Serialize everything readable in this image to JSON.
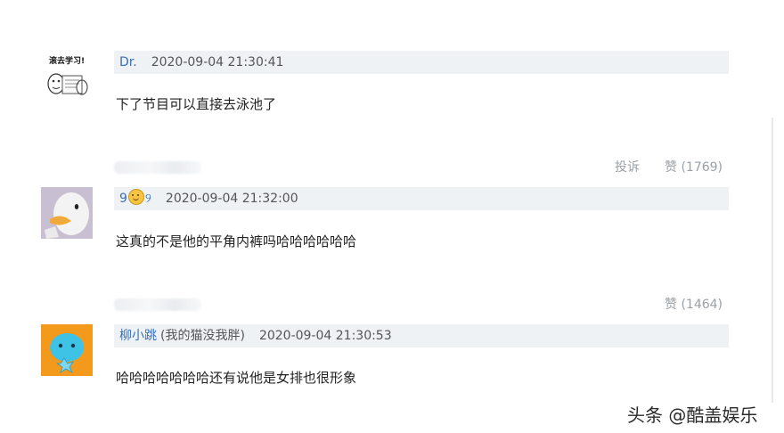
{
  "comments": [
    {
      "username": "Dr.",
      "username_prefix": "",
      "username_suffix": "",
      "note": "",
      "time": "2020-09-04 21:30:41",
      "text": "下了节目可以直接去泳池了",
      "avatar_caption": "滚去学习!",
      "actions": []
    },
    {
      "username": "",
      "username_prefix": "9",
      "username_suffix": "୨",
      "note": "",
      "time": "2020-09-04 21:32:00",
      "text": "这真的不是他的平角内裤吗哈哈哈哈哈哈",
      "avatar_caption": "",
      "actions": [
        "投诉",
        "赞 (1769)"
      ]
    },
    {
      "username": "柳小跳",
      "username_prefix": "",
      "username_suffix": "",
      "note": "(我的猫没我胖)",
      "time": "2020-09-04 21:30:53",
      "text": "哈哈哈哈哈哈哈还有说他是女排也很形象",
      "avatar_caption": "",
      "actions": [
        "赞 (1464)"
      ]
    }
  ],
  "watermark": "头条 @酷盖娱乐",
  "colors": {
    "meta_bar_bg": "#eef2f5",
    "username": "#3a6fb0",
    "action": "#9aa0a6",
    "avatar3_bg": "#f39a1c",
    "avatar3_figure": "#3ec3e6"
  }
}
